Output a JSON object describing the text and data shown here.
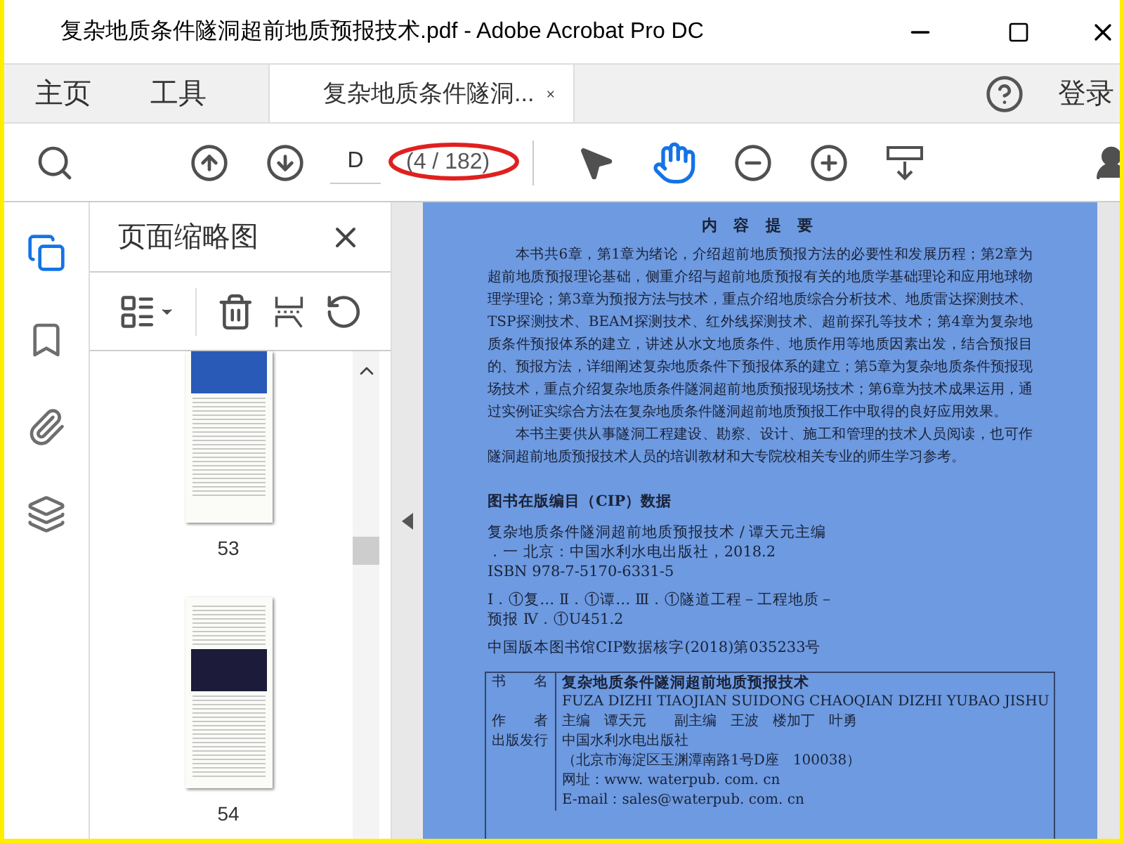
{
  "window": {
    "title": "复杂地质条件隧洞超前地质预报技术.pdf - Adobe Acrobat Pro DC"
  },
  "tabs": [
    {
      "kind": "nav",
      "label": "主页",
      "selected": false
    },
    {
      "kind": "nav",
      "label": "工具",
      "selected": false
    },
    {
      "kind": "document",
      "label": "复杂地质条件隧洞...",
      "selected": true
    }
  ],
  "sign_in": "登录",
  "toolbar": {
    "page_input": {
      "value": "D"
    },
    "page_count": "(4 / 182)",
    "tools": [
      {
        "kind": "select",
        "selected": false
      },
      {
        "kind": "hand",
        "selected": true
      }
    ]
  },
  "sidebar": {
    "items": [
      {
        "kind": "pages",
        "selected": true
      },
      {
        "kind": "bookmarks",
        "selected": false
      },
      {
        "kind": "attachments",
        "selected": false
      },
      {
        "kind": "layers",
        "selected": false
      }
    ]
  },
  "thumbnail_panel": {
    "title": "页面缩略图",
    "thumbnails": [
      {
        "page": "53",
        "selected": false
      },
      {
        "page": "54",
        "selected": false
      }
    ]
  },
  "document": {
    "heading": "内 容 提 要",
    "paragraphs": [
      "本书共6章，第1章为绪论，介绍超前地质预报方法的必要性和发展历程；第2章为超前地质预报理论基础，侧重介绍与超前地质预报有关的地质学基础理论和应用地球物理学理论；第3章为预报方法与技术，重点介绍地质综合分析技术、地质雷达探测技术、TSP探测技术、BEAM探测技术、红外线探测技术、超前探孔等技术；第4章为复杂地质条件预报体系的建立，讲述从水文地质条件、地质作用等地质因素出发，结合预报目的、预报方法，详细阐述复杂地质条件下预报体系的建立；第5章为复杂地质条件预报现场技术，重点介绍复杂地质条件隧洞超前地质预报现场技术；第6章为技术成果运用，通过实例证实综合方法在复杂地质条件隧洞超前地质预报工作中取得的良好应用效果。",
      "本书主要供从事隧洞工程建设、勘察、设计、施工和管理的技术人员阅读，也可作隧洞超前地质预报技术人员的培训教材和大专院校相关专业的师生学习参考。"
    ],
    "cip_title": "图书在版编目（CIP）数据",
    "cip_lines": [
      "复杂地质条件隧洞超前地质预报技术 / 谭天元主编",
      "．一 北京：中国水利水电出版社，2018.2",
      "ISBN 978-7-5170-6331-5",
      "Ⅰ．①复… Ⅱ．①谭… Ⅲ．①隧道工程－工程地质－",
      "预报 Ⅳ．①U451.2",
      "中国版本图书馆CIP数据核字(2018)第035233号"
    ],
    "info_table": [
      {
        "label": "书　　名",
        "values": [
          "复杂地质条件隧洞超前地质预报技术",
          "FUZA DIZHI TIAOJIAN SUIDONG CHAOQIAN DIZHI YUBAO JISHU"
        ]
      },
      {
        "label": "作　　者",
        "values": [
          "主编　谭天元　　副主编　王波　楼加丁　叶勇"
        ]
      },
      {
        "label": "出版发行",
        "values": [
          "中国水利水电出版社",
          "（北京市海淀区玉渊潭南路1号D座　100038）",
          "网址：www. waterpub. com. cn",
          "E-mail：sales@waterpub. com. cn"
        ]
      }
    ]
  }
}
